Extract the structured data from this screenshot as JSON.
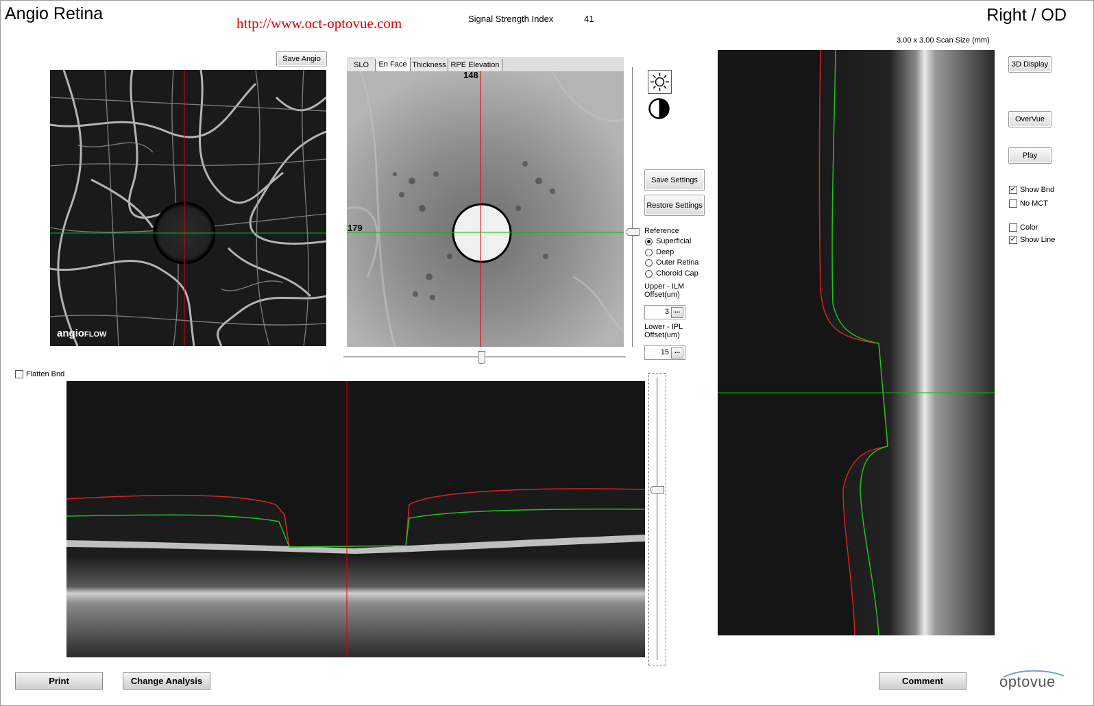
{
  "header": {
    "app_title": "Angio Retina",
    "url_text": "http://www.oct-optovue.com",
    "signal_label": "Signal Strength Index",
    "signal_value": "41",
    "eye_label": "Right / OD",
    "scan_size": "3.00 x 3.00 Scan Size (mm)"
  },
  "angio_panel": {
    "save_label": "Save Angio",
    "watermark_bold": "angio",
    "watermark_small": "FLOW"
  },
  "enface_panel": {
    "tabs": [
      {
        "label": "SLO"
      },
      {
        "label": "En Face"
      },
      {
        "label": "Thickness"
      },
      {
        "label": "RPE Elevation"
      }
    ],
    "active_tab": "En Face",
    "top_marker": "148",
    "left_marker": "179"
  },
  "settings": {
    "brightness_icon": "sun-icon",
    "contrast_icon": "contrast-icon",
    "save_settings": "Save Settings",
    "restore_settings": "Restore Settings",
    "reference_label": "Reference",
    "reference_options": [
      {
        "label": "Superficial",
        "selected": true
      },
      {
        "label": "Deep",
        "selected": false
      },
      {
        "label": "Outer Retina",
        "selected": false
      },
      {
        "label": "Choroid Cap",
        "selected": false
      }
    ],
    "upper_label_1": "Upper - ILM",
    "upper_label_2": "Offset(um)",
    "upper_value": "3",
    "lower_label_1": "Lower - IPL",
    "lower_label_2": "Offset(um)",
    "lower_value": "15",
    "dots": "..."
  },
  "right_controls": {
    "display_3d": "3D Display",
    "overvue": "OverVue",
    "play": "Play",
    "checkboxes": [
      {
        "label": "Show Bnd",
        "checked": true
      },
      {
        "label": "No MCT",
        "checked": false
      },
      {
        "label": "Color",
        "checked": false
      },
      {
        "label": "Show Line",
        "checked": true
      }
    ]
  },
  "bscan": {
    "flatten_label": "Flatten Bnd",
    "flatten_checked": false
  },
  "footer": {
    "print": "Print",
    "change_analysis": "Change Analysis",
    "comment": "Comment",
    "logo_text": "optovue"
  },
  "colors": {
    "ilm_line": "#e02020",
    "ipl_line": "#20c020",
    "crosshair_red": "#e00000",
    "crosshair_green": "#00c000",
    "url_red": "#e00000"
  }
}
